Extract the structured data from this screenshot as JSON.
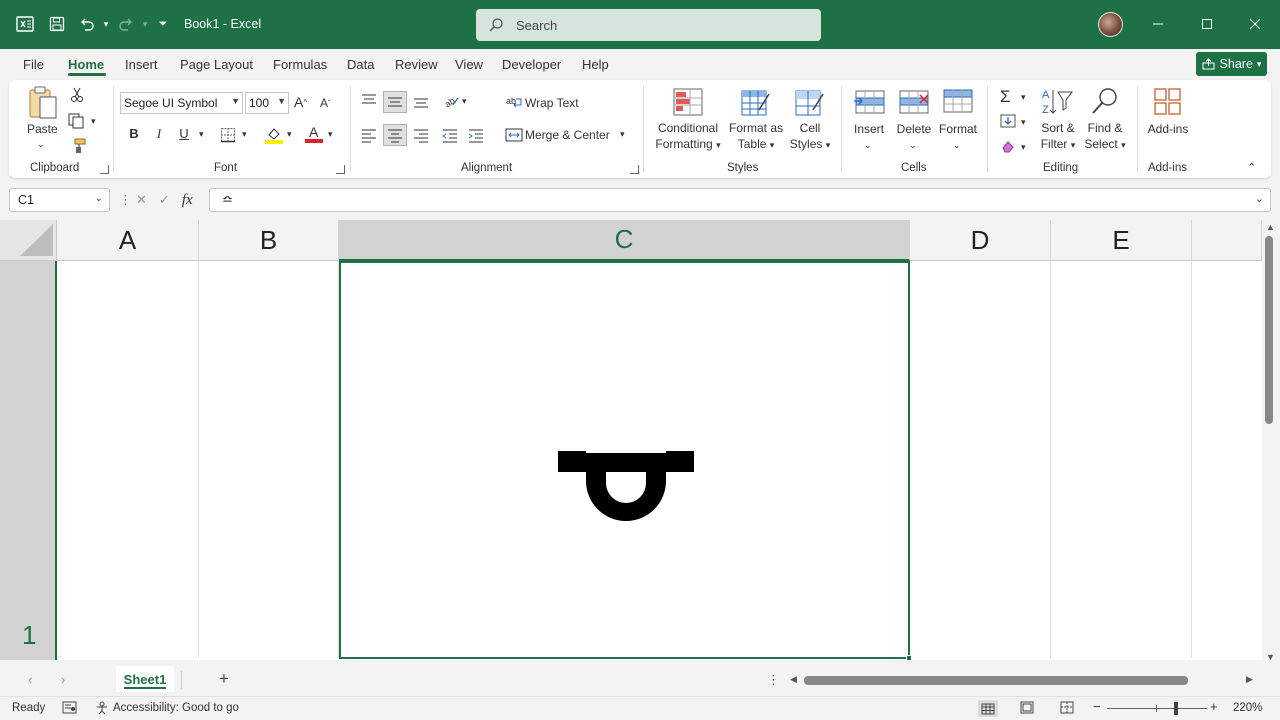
{
  "app": {
    "doc_title": "Book1  -  Excel",
    "search_placeholder": "Search"
  },
  "menu": {
    "tabs": [
      "File",
      "Home",
      "Insert",
      "Page Layout",
      "Formulas",
      "Data",
      "Review",
      "View",
      "Developer",
      "Help"
    ],
    "active_tab": "Home",
    "share_label": "Share"
  },
  "ribbon": {
    "clipboard": {
      "paste_label": "Paste",
      "group_label": "Clipboard"
    },
    "font": {
      "font_name": "Segoe UI Symbol",
      "font_size": "100",
      "group_label": "Font",
      "bold": "B",
      "italic": "I",
      "underline": "U"
    },
    "alignment": {
      "wrap_text": "Wrap Text",
      "merge_center": "Merge & Center",
      "group_label": "Alignment"
    },
    "styles": {
      "conditional_formatting": [
        "Conditional",
        "Formatting"
      ],
      "format_as_table": [
        "Format as",
        "Table"
      ],
      "cell_styles": [
        "Cell",
        "Styles"
      ],
      "group_label": "Styles"
    },
    "cells": {
      "insert": "Insert",
      "delete": "Delete",
      "format": "Format",
      "group_label": "Cells"
    },
    "editing": {
      "sort_filter": [
        "Sort &",
        "Filter"
      ],
      "find_select": [
        "Find &",
        "Select"
      ],
      "group_label": "Editing"
    },
    "addins": {
      "label": "Add-ins",
      "group_label": "Add-ins"
    }
  },
  "formula_bar": {
    "name_box": "C1",
    "formula": "≏"
  },
  "grid": {
    "columns": [
      "A",
      "B",
      "C",
      "D",
      "E"
    ],
    "selected_column": "C",
    "row_number": "1",
    "active_cell_value": "≏"
  },
  "sheets": {
    "tabs": [
      "Sheet1"
    ],
    "add_sheet": "+"
  },
  "status": {
    "ready": "Ready",
    "accessibility": "Accessibility: Good to go",
    "zoom": "220%"
  },
  "colors": {
    "accent": "#1e7145",
    "selected_header": "#d2d2d2"
  }
}
